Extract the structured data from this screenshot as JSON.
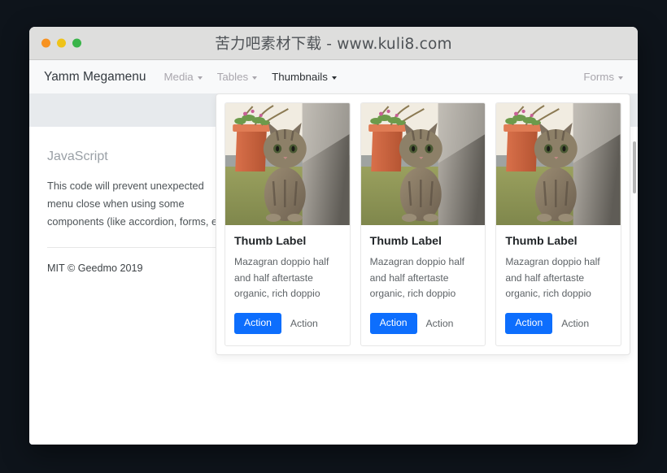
{
  "window": {
    "title": "苦力吧素材下载 - www.kuli8.com",
    "traffic_lights": [
      "close-red-dot",
      "minimize-yellow-dot",
      "maximize-green-dot"
    ]
  },
  "navbar": {
    "brand": "Yamm Megamenu",
    "items": [
      {
        "label": "Media",
        "has_caret": true,
        "active": false
      },
      {
        "label": "Tables",
        "has_caret": true,
        "active": false
      },
      {
        "label": "Thumbnails",
        "has_caret": true,
        "active": true
      }
    ],
    "right_items": [
      {
        "label": "Forms",
        "has_caret": true,
        "active": false
      }
    ]
  },
  "content": {
    "heading": "JavaScript",
    "description": "This code will prevent unexpected menu close when using some components (like accordion, forms, etc)",
    "license": "MIT © Geedmo 2019"
  },
  "megamenu": {
    "open_for": "Thumbnails",
    "cards": [
      {
        "image_alt": "tabby-kitten-beside-terracotta-flower-pot",
        "title": "Thumb Label",
        "text": "Mazagran doppio half and half aftertaste organic, rich doppio",
        "primary_action": "Action",
        "secondary_action": "Action"
      },
      {
        "image_alt": "tabby-kitten-beside-terracotta-flower-pot",
        "title": "Thumb Label",
        "text": "Mazagran doppio half and half aftertaste organic, rich doppio",
        "primary_action": "Action",
        "secondary_action": "Action"
      },
      {
        "image_alt": "tabby-kitten-beside-terracotta-flower-pot",
        "title": "Thumb Label",
        "text": "Mazagran doppio half and half aftertaste organic, rich doppio",
        "primary_action": "Action",
        "secondary_action": "Action"
      }
    ]
  },
  "colors": {
    "primary": "#0d6efd",
    "navbar_bg": "#f8f9fa",
    "band_bg": "#e7eaed",
    "titlebar_bg": "#dededd",
    "page_bg": "#0e141b",
    "muted_text": "#a9a6ad"
  }
}
